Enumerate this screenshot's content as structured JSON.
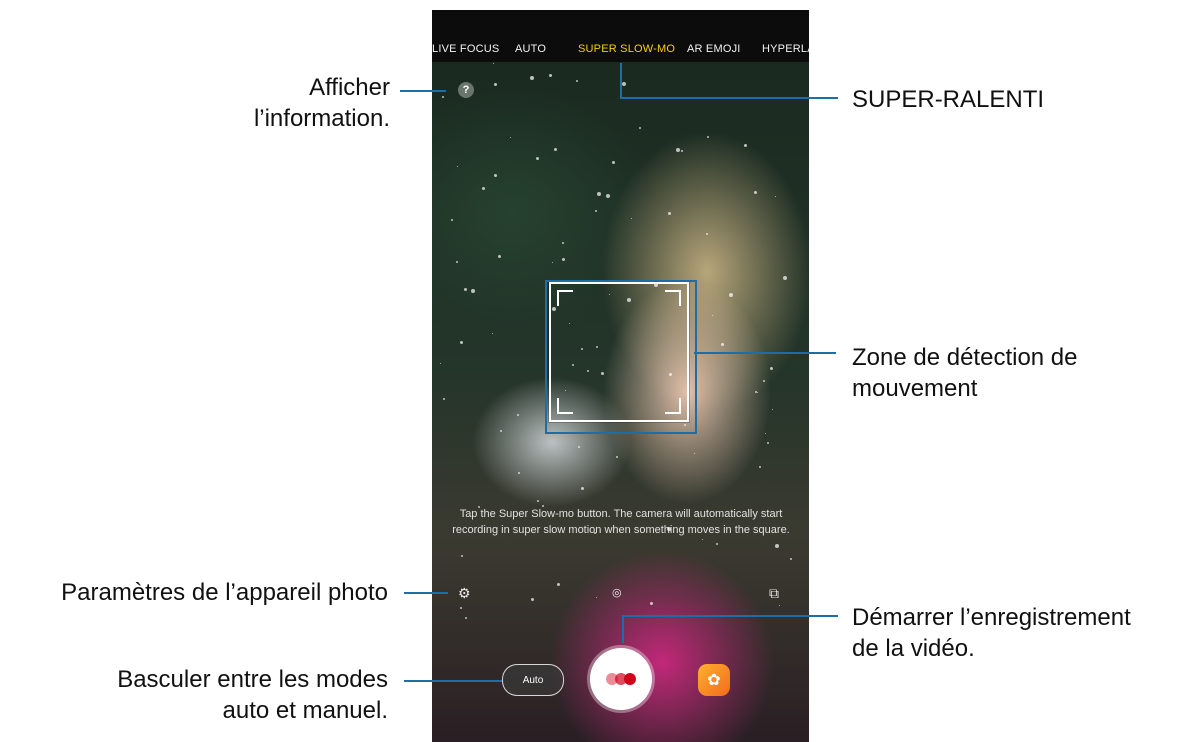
{
  "camera": {
    "modes": [
      {
        "label": "LIVE FOCUS",
        "active": false
      },
      {
        "label": "AUTO",
        "active": false
      },
      {
        "label": "SUPER SLOW-MO",
        "active": true
      },
      {
        "label": "AR EMOJI",
        "active": false
      },
      {
        "label": "HYPERLA",
        "active": false
      }
    ],
    "help_symbol": "?",
    "hint_text": "Tap the Super Slow-mo button. The camera will automatically start recording in super slow motion when something moves in the square.",
    "auto_toggle_label": "Auto",
    "active_mode_color": "#f5d000",
    "record_color": "#d0021b"
  },
  "callouts": {
    "info_line1": "Afficher",
    "info_line2": "l’information.",
    "super_slow": "SUPER-RALENTI",
    "detect_line1": "Zone de détection de",
    "detect_line2": "mouvement",
    "settings": "Paramètres de l’appareil photo",
    "record_line1": "Démarrer l’enregistrement",
    "record_line2": "de la vidéo.",
    "toggle_line1": "Basculer entre les modes",
    "toggle_line2": "auto et manuel.",
    "line_color": "#1b6ea8"
  },
  "icons": {
    "help": "help-icon",
    "settings": "gear-icon",
    "flash": "flash-icon",
    "switch": "switch-camera-icon",
    "effects": "effects-icon"
  }
}
